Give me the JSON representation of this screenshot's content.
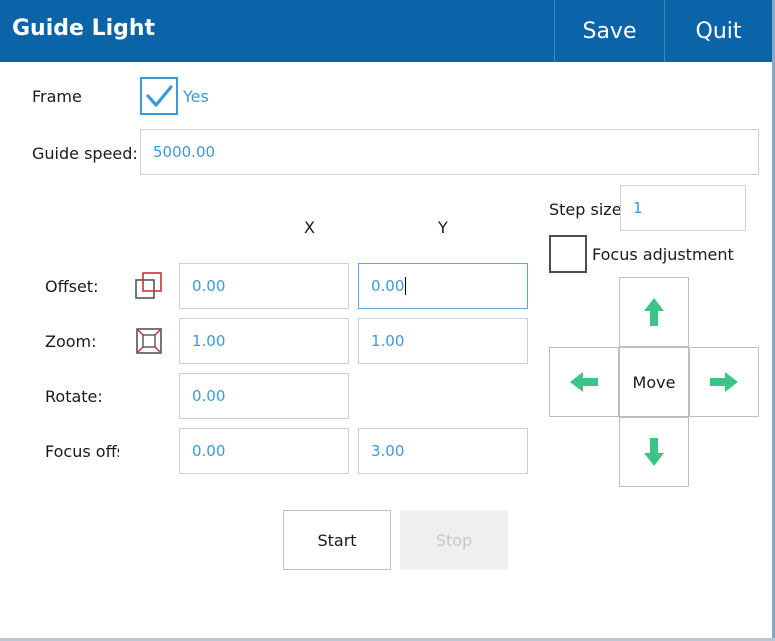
{
  "window": {
    "title": "Guide Light",
    "save_label": "Save",
    "quit_label": "Quit"
  },
  "frame": {
    "label": "Frame",
    "checked": true,
    "option_label": "Yes"
  },
  "guide_speed": {
    "label": "Guide speed:",
    "value": "5000.00"
  },
  "axes": {
    "x": "X",
    "y": "Y"
  },
  "offset": {
    "label": "Offset:",
    "x": "0.00",
    "y": "0.00",
    "icon": "offset-icon"
  },
  "zoom": {
    "label": "Zoom:",
    "x": "1.00",
    "y": "1.00",
    "icon": "zoom-icon"
  },
  "rotate": {
    "label": "Rotate:",
    "value": "0.00"
  },
  "focus_offset": {
    "label": "Focus offs",
    "x": "0.00",
    "y": "3.00"
  },
  "step_size": {
    "label": "Step size:",
    "value": "1"
  },
  "focus_adjustment": {
    "label": "Focus adjustment",
    "checked": false
  },
  "move": {
    "center_label": "Move",
    "icons": [
      "arrow-up-icon",
      "arrow-left-icon",
      "arrow-right-icon",
      "arrow-down-icon"
    ]
  },
  "actions": {
    "start_label": "Start",
    "stop_label": "Stop"
  },
  "colors": {
    "titlebar": "#0b64a8",
    "accent": "#3b9ad9",
    "arrow": "#3cc386",
    "icon_red": "#c8323c"
  }
}
